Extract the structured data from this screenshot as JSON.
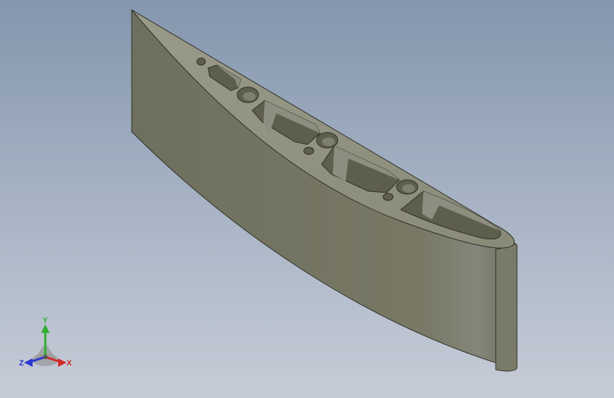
{
  "viewport": {
    "background_top": "#8496ad",
    "background_bottom": "#c6ccd7"
  },
  "model": {
    "part": "airfoil-rib-extrusion",
    "face_color": "#73735f",
    "top_color": "#8a8a76",
    "cutout_color": "#5e5e4c",
    "edge_color": "#2e2e26"
  },
  "triad": {
    "x_label": "X",
    "y_label": "Y",
    "z_label": "Z",
    "x_color": "#d22a2a",
    "y_color": "#2fae2f",
    "z_color": "#2a36d2"
  }
}
